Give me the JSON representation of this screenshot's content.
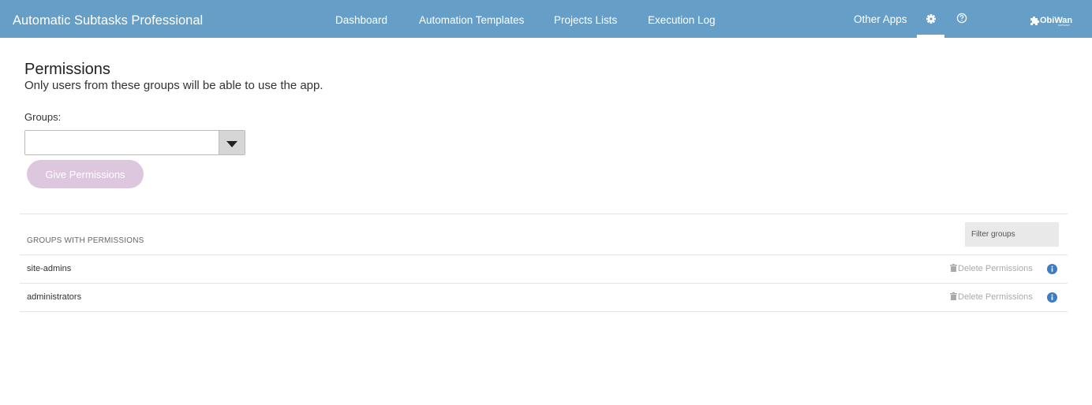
{
  "header": {
    "app_title": "Automatic Subtasks Professional",
    "nav": [
      "Dashboard",
      "Automation Templates",
      "Projects Lists",
      "Execution Log"
    ],
    "other_apps": "Other Apps",
    "brand": "ObiWan",
    "brand_sub": "software"
  },
  "page": {
    "title": "Permissions",
    "subtitle": "Only users from these groups will be able to use the app.",
    "groups_label": "Groups:",
    "groups_select_value": "",
    "give_button": "Give Permissions"
  },
  "table": {
    "header": "GROUPS WITH PERMISSIONS",
    "filter_placeholder": "Filter groups",
    "rows": [
      {
        "name": "site-admins",
        "delete_label": "Delete Permissions"
      },
      {
        "name": "administrators",
        "delete_label": "Delete Permissions"
      }
    ]
  },
  "colors": {
    "header_bg": "#659fc7",
    "button_disabled": "#dcc7df",
    "info_icon": "#3d7cc0"
  },
  "icons": {
    "settings": "gear-icon",
    "help": "help-circle-icon",
    "dropdown": "caret-down-icon",
    "delete": "trash-icon",
    "info": "info-icon"
  }
}
